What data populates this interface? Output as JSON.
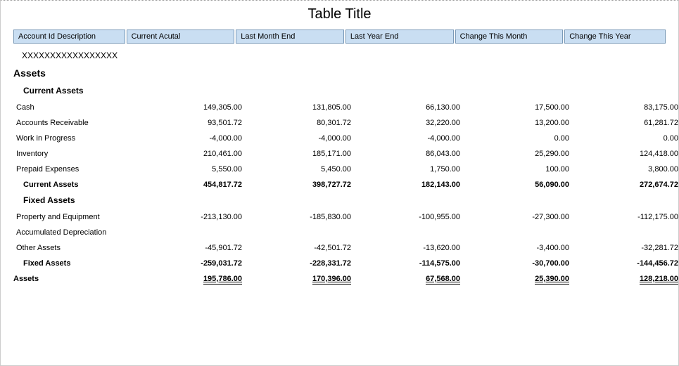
{
  "title": "Table Title",
  "headers": [
    "Account Id Description",
    "Current Acutal",
    "Last Month End",
    "Last Year End",
    "Change This Month",
    "Change This Year"
  ],
  "xrow": "XXXXXXXXXXXXXXXXX",
  "section": "Assets",
  "groups": [
    {
      "name": "Current Assets",
      "rows": [
        {
          "label": "Cash",
          "v": [
            "149,305.00",
            "131,805.00",
            "66,130.00",
            "17,500.00",
            "83,175.00"
          ]
        },
        {
          "label": "Accounts Receivable",
          "v": [
            "93,501.72",
            "80,301.72",
            "32,220.00",
            "13,200.00",
            "61,281.72"
          ]
        },
        {
          "label": "Work in Progress",
          "v": [
            "-4,000.00",
            "-4,000.00",
            "-4,000.00",
            "0.00",
            "0.00"
          ]
        },
        {
          "label": "Inventory",
          "v": [
            "210,461.00",
            "185,171.00",
            "86,043.00",
            "25,290.00",
            "124,418.00"
          ]
        },
        {
          "label": "Prepaid Expenses",
          "v": [
            "5,550.00",
            "5,450.00",
            "1,750.00",
            "100.00",
            "3,800.00"
          ]
        }
      ],
      "subtotal": {
        "label": "Current Assets",
        "v": [
          "454,817.72",
          "398,727.72",
          "182,143.00",
          "56,090.00",
          "272,674.72"
        ]
      }
    },
    {
      "name": "Fixed Assets",
      "rows": [
        {
          "label": "Property and Equipment",
          "v": [
            "-213,130.00",
            "-185,830.00",
            "-100,955.00",
            "-27,300.00",
            "-112,175.00"
          ]
        },
        {
          "label": "Accumulated Depreciation",
          "v": [
            "",
            "",
            "",
            "",
            ""
          ]
        },
        {
          "label": "Other Assets",
          "v": [
            "-45,901.72",
            "-42,501.72",
            "-13,620.00",
            "-3,400.00",
            "-32,281.72"
          ]
        }
      ],
      "subtotal": {
        "label": "Fixed Assets",
        "v": [
          "-259,031.72",
          "-228,331.72",
          "-114,575.00",
          "-30,700.00",
          "-144,456.72"
        ]
      }
    }
  ],
  "grand": {
    "label": "Assets",
    "v": [
      "195,786.00",
      "170,396.00",
      "67,568.00",
      "25,390.00",
      "128,218.00"
    ]
  },
  "chart_data": {
    "type": "table",
    "title": "Table Title",
    "columns": [
      "Account Id Description",
      "Current Acutal",
      "Last Month End",
      "Last Year End",
      "Change This Month",
      "Change This Year"
    ],
    "rows": [
      [
        "Cash",
        149305.0,
        131805.0,
        66130.0,
        17500.0,
        83175.0
      ],
      [
        "Accounts Receivable",
        93501.72,
        80301.72,
        32220.0,
        13200.0,
        61281.72
      ],
      [
        "Work in Progress",
        -4000.0,
        -4000.0,
        -4000.0,
        0.0,
        0.0
      ],
      [
        "Inventory",
        210461.0,
        185171.0,
        86043.0,
        25290.0,
        124418.0
      ],
      [
        "Prepaid Expenses",
        5550.0,
        5450.0,
        1750.0,
        100.0,
        3800.0
      ],
      [
        "Current Assets (subtotal)",
        454817.72,
        398727.72,
        182143.0,
        56090.0,
        272674.72
      ],
      [
        "Property and Equipment",
        -213130.0,
        -185830.0,
        -100955.0,
        -27300.0,
        -112175.0
      ],
      [
        "Accumulated Depreciation",
        null,
        null,
        null,
        null,
        null
      ],
      [
        "Other Assets",
        -45901.72,
        -42501.72,
        -13620.0,
        -3400.0,
        -32281.72
      ],
      [
        "Fixed Assets (subtotal)",
        -259031.72,
        -228331.72,
        -114575.0,
        -30700.0,
        -144456.72
      ],
      [
        "Assets (total)",
        195786.0,
        170396.0,
        67568.0,
        25390.0,
        128218.0
      ]
    ]
  }
}
